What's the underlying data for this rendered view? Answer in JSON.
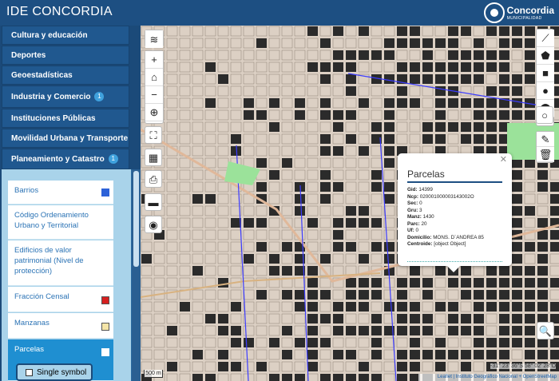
{
  "header": {
    "title": "IDE CONCORDIA",
    "logo_name": "Concordia",
    "logo_sub": "MUNICIPALIDAD"
  },
  "sidebar": {
    "categories": [
      {
        "label": "Cultura y educación",
        "badge": ""
      },
      {
        "label": "Deportes",
        "badge": ""
      },
      {
        "label": "Geoestadísticas",
        "badge": ""
      },
      {
        "label": "Industria y Comercio",
        "badge": "1"
      },
      {
        "label": "Instituciones Públicas",
        "badge": ""
      },
      {
        "label": "Movilidad Urbana y Transporte",
        "badge": ""
      },
      {
        "label": "Planeamiento y Catastro",
        "badge": "1"
      }
    ],
    "layers": [
      {
        "label": "Barrios",
        "swatch": "#2d62d8"
      },
      {
        "label": "Código Ordenamiento Urbano y Territorial",
        "swatch": ""
      },
      {
        "label": "Edificios de valor patrimonial (Nivel de protección)",
        "swatch": ""
      },
      {
        "label": "Fracción Censal",
        "swatch": "#d62020"
      },
      {
        "label": "Manzanas",
        "swatch": "#f5e5a8"
      },
      {
        "label": "Parcelas",
        "swatch": "#ffffff"
      }
    ],
    "sub_option": "Single symbol"
  },
  "toolbar_left": [
    {
      "name": "layers-icon",
      "glyph": "≋"
    },
    {
      "name": "zoom-in-icon",
      "glyph": "+"
    },
    {
      "name": "home-icon",
      "glyph": "⌂"
    },
    {
      "name": "zoom-out-icon",
      "glyph": "−"
    },
    {
      "name": "locate-icon",
      "glyph": "⊕"
    },
    {
      "name": "fullscreen-icon",
      "glyph": "⛶"
    },
    {
      "name": "grid-icon",
      "glyph": "▦"
    },
    {
      "name": "print-icon",
      "glyph": "⎙"
    },
    {
      "name": "folder-icon",
      "glyph": "▬"
    },
    {
      "name": "camera-icon",
      "glyph": "◉"
    }
  ],
  "toolbar_right": [
    {
      "name": "draw-line-icon",
      "glyph": "⟋"
    },
    {
      "name": "draw-polygon-icon",
      "glyph": "⬟"
    },
    {
      "name": "draw-rectangle-icon",
      "glyph": "■"
    },
    {
      "name": "draw-circle-icon",
      "glyph": "●"
    },
    {
      "name": "draw-marker-icon",
      "glyph": "⬤"
    },
    {
      "name": "draw-circle-marker-icon",
      "glyph": "○"
    },
    {
      "name": "edit-icon",
      "glyph": "✎"
    },
    {
      "name": "delete-icon",
      "glyph": "🗑"
    }
  ],
  "popup": {
    "title": "Parcelas",
    "fields": [
      {
        "k": "Gid:",
        "v": "14399"
      },
      {
        "k": "Ncp:",
        "v": "020001000003143002O"
      },
      {
        "k": "Sec:",
        "v": "0"
      },
      {
        "k": "Gru:",
        "v": "3"
      },
      {
        "k": "Manz:",
        "v": "1430"
      },
      {
        "k": "Parc:",
        "v": "20"
      },
      {
        "k": "Uf:",
        "v": "0"
      },
      {
        "k": "Domicilio:",
        "v": "MONS. D´ANDREA 85"
      },
      {
        "k": "Centroide:",
        "v": "[object Object]"
      }
    ]
  },
  "map": {
    "scale": "500 m",
    "coords": "-31° 23' 36\"S 58° 02' 28\"O",
    "attribution": "Leaflet | Instituto Geográfico Nacional + OpenStreetMap"
  },
  "search_icon": "🔍"
}
